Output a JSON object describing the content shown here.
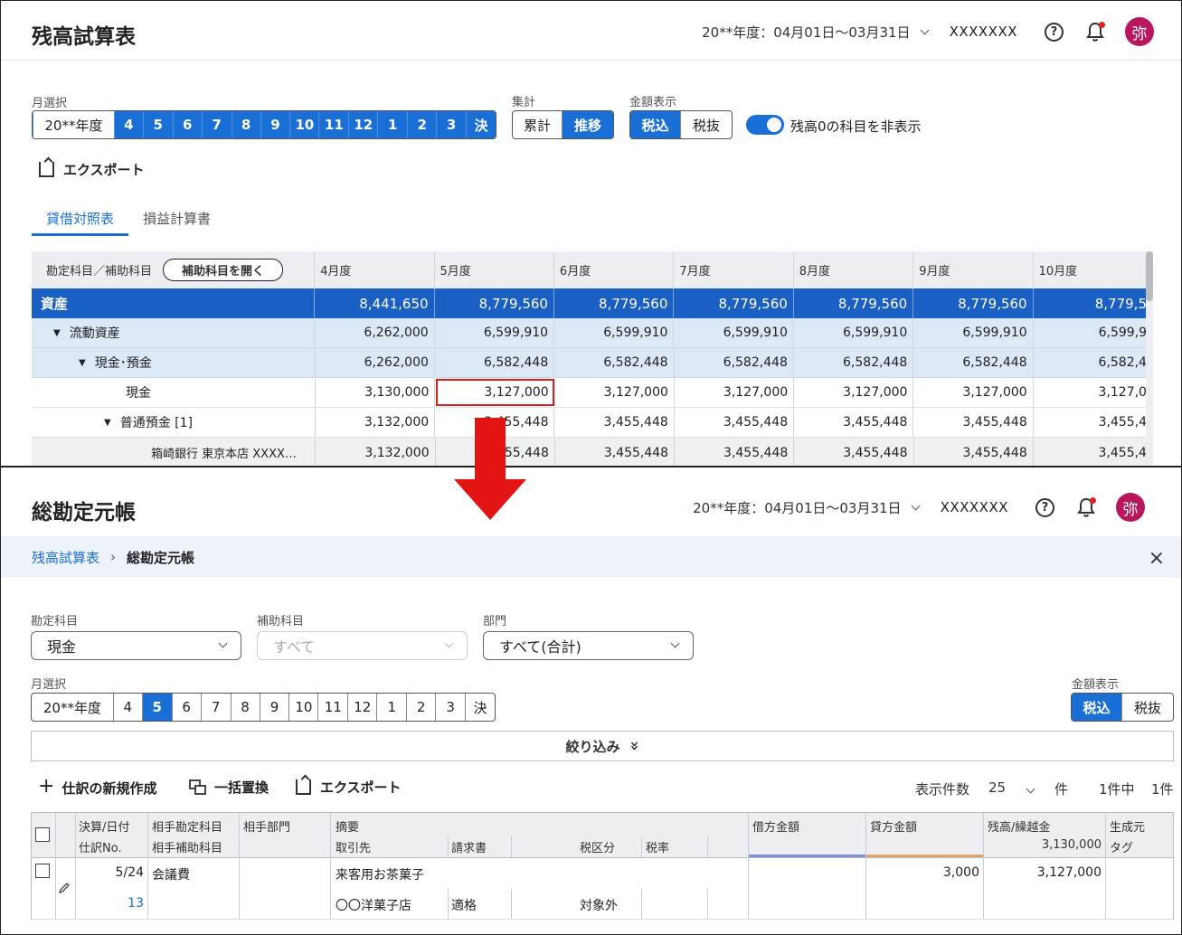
{
  "top": {
    "title": "残高試算表",
    "period": "20**年度：04月01日〜03月31日",
    "user": "XXXXXXX",
    "help": "?",
    "avatar": "弥",
    "month_label": "月選択",
    "months": [
      "20**年度",
      "4",
      "5",
      "6",
      "7",
      "8",
      "9",
      "10",
      "11",
      "12",
      "1",
      "2",
      "3",
      "決"
    ],
    "agg_label": "集計",
    "agg": [
      "累計",
      "推移"
    ],
    "amount_label": "金額表示",
    "amount": [
      "税込",
      "税抜"
    ],
    "toggle_text": "残高0の科目を非表示",
    "toggle_on": true,
    "export": "エクスポート",
    "tabs": [
      "貸借対照表",
      "損益計算書"
    ],
    "table": {
      "head_label": "勘定科目／補助科目",
      "open_sub": "補助科目を開く",
      "months": [
        "4月度",
        "5月度",
        "6月度",
        "7月度",
        "8月度",
        "9月度",
        "10月度"
      ],
      "rows": [
        {
          "name": "資産",
          "values": [
            "8,441,650",
            "8,779,560",
            "8,779,560",
            "8,779,560",
            "8,779,560",
            "8,779,560",
            "8,779,5"
          ]
        },
        {
          "name": "流動資産",
          "values": [
            "6,262,000",
            "6,599,910",
            "6,599,910",
            "6,599,910",
            "6,599,910",
            "6,599,910",
            "6,599,9"
          ]
        },
        {
          "name": "現金･預金",
          "values": [
            "6,262,000",
            "6,582,448",
            "6,582,448",
            "6,582,448",
            "6,582,448",
            "6,582,448",
            "6,582,4"
          ]
        },
        {
          "name": "現金",
          "values": [
            "3,130,000",
            "3,127,000",
            "3,127,000",
            "3,127,000",
            "3,127,000",
            "3,127,000",
            "3,127,0"
          ]
        },
        {
          "name": "普通預金 [1]",
          "values": [
            "3,132,000",
            "3,455,448",
            "3,455,448",
            "3,455,448",
            "3,455,448",
            "3,455,448",
            "3,455,4"
          ]
        },
        {
          "name": "箱崎銀行 東京本店 XXXX…",
          "values": [
            "3,132,000",
            "3,455,448",
            "3,455,448",
            "3,455,448",
            "3,455,448",
            "3,455,448",
            "3,455,4"
          ]
        }
      ]
    }
  },
  "bottom": {
    "title": "総勘定元帳",
    "period": "20**年度：04月01日〜03月31日",
    "user": "XXXXXXX",
    "help": "?",
    "avatar": "弥",
    "breadcrumb": {
      "link": "残高試算表",
      "sep": "›",
      "current": "総勘定元帳"
    },
    "close": "×",
    "account_label": "勘定科目",
    "account_value": "現金",
    "sub_label": "補助科目",
    "sub_placeholder": "すべて",
    "dept_label": "部門",
    "dept_value": "すべて(合計)",
    "month_label": "月選択",
    "months": [
      "20**年度",
      "4",
      "5",
      "6",
      "7",
      "8",
      "9",
      "10",
      "11",
      "12",
      "1",
      "2",
      "3",
      "決"
    ],
    "amount_label": "金額表示",
    "amount": [
      "税込",
      "税抜"
    ],
    "filter": "絞り込み",
    "filter_icon": "»",
    "actions": {
      "new": "仕訳の新規作成",
      "replace": "一括置換",
      "export": "エクスポート"
    },
    "page_info": {
      "label": "表示件数",
      "size": "25",
      "unit": "件",
      "count": "1件中",
      "total": "1件"
    },
    "ledger": {
      "h": {
        "date": "決算/日付",
        "no": "仕訳No.",
        "acct": "相手勘定科目",
        "subacct": "相手補助科目",
        "dept": "相手部門",
        "memo": "摘要",
        "partner": "取引先",
        "invoice": "請求書",
        "taxcat": "税区分",
        "taxrate": "税率",
        "debit": "借方金額",
        "credit": "貸方金額",
        "balance": "残高/繰越金",
        "carry": "3,130,000",
        "origin": "生成元",
        "tag": "タグ"
      },
      "row": {
        "date": "5/24",
        "no": "13",
        "acct": "会議費",
        "memo": "来客用お茶菓子",
        "partner": "〇〇洋菓子店",
        "invoice": "適格",
        "taxcat": "対象外",
        "credit": "3,000",
        "balance": "3,127,000"
      }
    }
  }
}
